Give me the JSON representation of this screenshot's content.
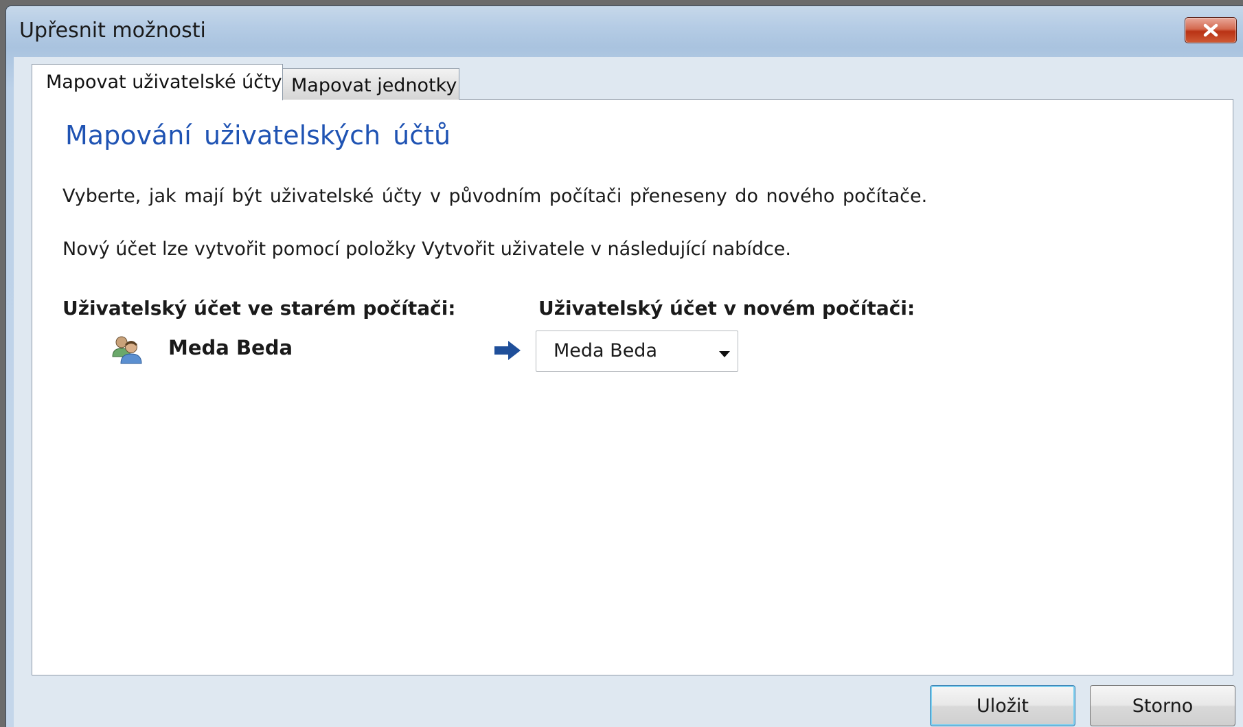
{
  "window": {
    "title": "Upřesnit možnosti",
    "close_icon": "close-x-icon"
  },
  "tabs": [
    {
      "label": "Mapovat uživatelské účty",
      "active": true
    },
    {
      "label": "Mapovat jednotky",
      "active": false
    }
  ],
  "content": {
    "heading": "Mapování uživatelských účtů",
    "paragraph1": "Vyberte, jak mají být uživatelské účty v původním počítači přeneseny do nového počítače.",
    "paragraph2": "Nový účet lze vytvořit pomocí položky Vytvořit uživatele v následující nabídce.",
    "old_account_label": "Uživatelský účet ve starém počítači:",
    "new_account_label": "Uživatelský účet v novém počítači:",
    "old_account_name": "Meda Beda",
    "user_icon": "users-icon",
    "arrow_icon": "arrow-right-icon",
    "new_account_selected": "Meda Beda"
  },
  "buttons": {
    "save": "Uložit",
    "cancel": "Storno"
  },
  "colors": {
    "heading": "#1f53b3",
    "arrow": "#1f4f9a",
    "close_button": "#c9442a"
  }
}
